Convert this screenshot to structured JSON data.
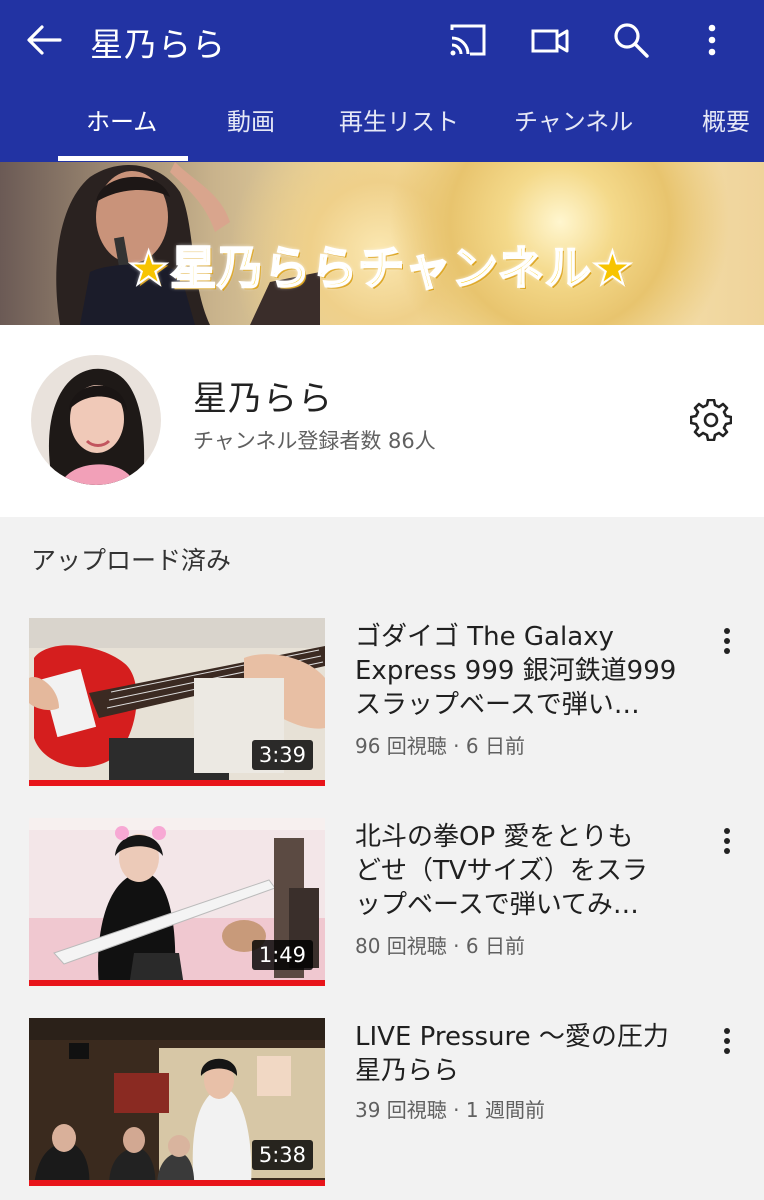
{
  "appbar": {
    "title": "星乃らら",
    "icons": [
      "back-arrow-icon",
      "cast-icon",
      "video-camera-icon",
      "search-icon",
      "more-vert-icon"
    ]
  },
  "tabs": [
    {
      "label": "ホーム",
      "active": true
    },
    {
      "label": "動画",
      "active": false
    },
    {
      "label": "再生リスト",
      "active": false
    },
    {
      "label": "チャンネル",
      "active": false
    },
    {
      "label": "概要",
      "active": false
    }
  ],
  "banner": {
    "text": "★星乃ららチャンネル★"
  },
  "channel": {
    "name": "星乃らら",
    "subscribers": "チャンネル登録者数 86人"
  },
  "section": {
    "title": "アップロード済み"
  },
  "videos": [
    {
      "title_line1": "ゴダイゴ The Galaxy",
      "title_line2": "Express 999 銀河鉄道999",
      "title_line3": "スラップベースで弾い…",
      "meta": "96 回視聴 · 6 日前",
      "duration": "3:39"
    },
    {
      "title_line1": "北斗の拳OP 愛をとりも",
      "title_line2": "どせ（TVサイズ）をスラ",
      "title_line3": "ップベースで弾いてみ…",
      "meta": "80 回視聴 · 6 日前",
      "duration": "1:49"
    },
    {
      "title_line1": "LIVE Pressure 〜愛の圧力",
      "title_line2": "星乃らら",
      "title_line3": "",
      "meta": "39 回視聴 · 1 週間前",
      "duration": "5:38"
    }
  ],
  "colors": {
    "appbar": "#2233a3",
    "progress": "#e8151b",
    "background": "#f2f2f2"
  }
}
